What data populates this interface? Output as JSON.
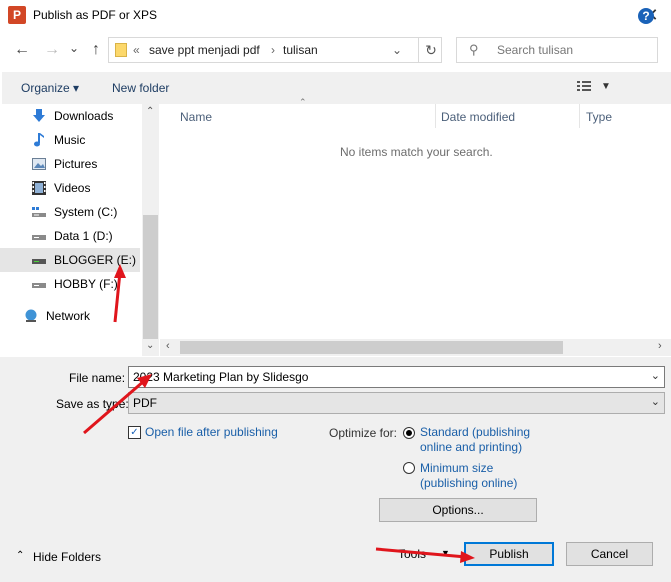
{
  "window": {
    "title": "Publish as PDF or XPS",
    "app_icon_letter": "P",
    "close_glyph": "✕"
  },
  "nav": {
    "back_glyph": "←",
    "forward_glyph": "→",
    "recent_glyph": "⌄",
    "up_glyph": "↑",
    "breadcrumb_prefix": "«",
    "breadcrumb": [
      "save ppt menjadi pdf",
      "tulisan"
    ],
    "separator": "›",
    "refresh_glyph": "↻",
    "search_placeholder": "Search tulisan"
  },
  "toolbar": {
    "organize": "Organize",
    "new_folder": "New folder",
    "help": "?"
  },
  "sidebar": {
    "items": [
      {
        "label": "Downloads",
        "icon": "download-icon"
      },
      {
        "label": "Music",
        "icon": "music-icon"
      },
      {
        "label": "Pictures",
        "icon": "pictures-icon"
      },
      {
        "label": "Videos",
        "icon": "videos-icon"
      },
      {
        "label": "System (C:)",
        "icon": "drive-icon"
      },
      {
        "label": "Data 1 (D:)",
        "icon": "drive-icon"
      },
      {
        "label": "BLOGGER (E:)",
        "icon": "drive-icon",
        "selected": true
      },
      {
        "label": "HOBBY (F:)",
        "icon": "drive-icon"
      },
      {
        "label": "Network",
        "icon": "network-icon"
      }
    ]
  },
  "filelist": {
    "columns": [
      "Name",
      "Date modified",
      "Type"
    ],
    "empty_message": "No items match your search."
  },
  "form": {
    "file_name_label": "File name:",
    "file_name_value": "2023 Marketing Plan by Slidesgo",
    "save_type_label": "Save as type:",
    "save_type_value": "PDF",
    "open_after_label": "Open file after publishing",
    "open_after_checked": true,
    "optimize_label": "Optimize for:",
    "standard_line1": "Standard (publishing",
    "standard_line2": "online and printing)",
    "minimum_line1": "Minimum size",
    "minimum_line2": "(publishing online)",
    "optimize_selected": "standard",
    "options_button": "Options..."
  },
  "footer": {
    "hide_folders": "Hide Folders",
    "tools": "Tools",
    "publish": "Publish",
    "cancel": "Cancel"
  },
  "colors": {
    "annotation_arrow": "#e0151c",
    "accent": "#0078d7"
  }
}
